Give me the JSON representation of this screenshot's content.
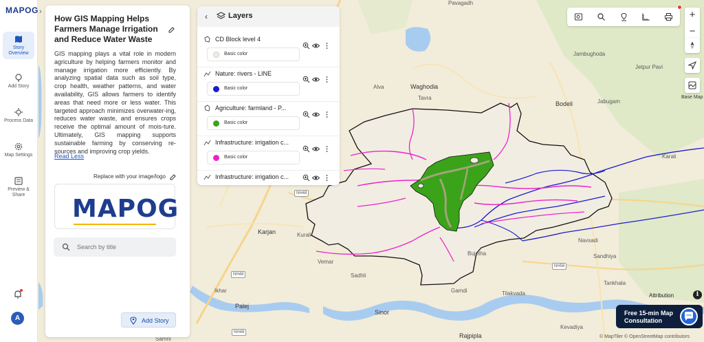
{
  "app": {
    "logo": "MAPOG"
  },
  "rail": {
    "items": [
      {
        "label": "Story Overview",
        "icon": "map-book-icon",
        "active": true
      },
      {
        "label": "Add Story",
        "icon": "pin-add-icon",
        "active": false
      },
      {
        "label": "Process Data",
        "icon": "process-icon",
        "active": false
      },
      {
        "label": "Map Settings",
        "icon": "gear-icon",
        "active": false
      },
      {
        "label": "Preview & Share",
        "icon": "preview-icon",
        "active": false
      }
    ],
    "avatar_initial": "A"
  },
  "story": {
    "title": "How GIS Mapping Helps Farmers Manage Irrigation and Reduce Water Waste",
    "body": "GIS mapping plays a vital role in modern agriculture by helping farmers monitor and manage irrigation more efficiently. By analyzing spatial data such as soil type, crop health, weather patterns, and water availability, GIS allows farmers to identify areas that need more or less water. This targeted approach minimizes overwater-ing, reduces water waste, and ensures crops receive the optimal amount of mois-ture. Ultimately, GIS mapping supports sustainable farming by conserving re-sources and improving crop yields.",
    "read_less": "Read Less",
    "replace_logo": "Replace with your image/logo",
    "logo_text": "MAPOG",
    "search_placeholder": "Search by title",
    "add_story": "Add Story"
  },
  "layers": {
    "title": "Layers",
    "items": [
      {
        "name": "CD Block level 4",
        "color_label": "Basic color",
        "color": "#f1ede2",
        "type": "polygon"
      },
      {
        "name": "Nature: rivers - LINE",
        "color_label": "Basic color",
        "color": "#1a1ad0",
        "type": "line"
      },
      {
        "name": "Agriculture: farmland - P...",
        "color_label": "Basic color",
        "color": "#3aa31a",
        "type": "polygon"
      },
      {
        "name": "Infrastructure: irrigation c...",
        "color_label": "Basic color",
        "color": "#ee22cc",
        "type": "line"
      },
      {
        "name": "Infrastructure: irrigation c...",
        "color_label": "",
        "color": "#ee22cc",
        "type": "line"
      }
    ]
  },
  "map": {
    "labels": [
      "Pavagadh",
      "Jambughoda",
      "Jetpur Pavi",
      "Alva",
      "Waghodia",
      "Tavra",
      "Bodeli",
      "Jabugam",
      "Karjan",
      "Kurali",
      "Vemar",
      "Sadhli",
      "Ikhar",
      "Palej",
      "Sinor",
      "Rajpipla",
      "Kevadiya",
      "Samni",
      "Gamdi",
      "Tilakvada",
      "Bujetha",
      "Navsadi",
      "Sandhiya",
      "Tankhala",
      "Karali"
    ],
    "shields": [
      "NH48",
      "NH48",
      "NH56",
      "NH48"
    ],
    "colors": {
      "boundary_fill": "#f1ede2",
      "river": "#1a1ad0",
      "farmland": "#3aa31a",
      "irrigation": "#ee22cc"
    }
  },
  "controls": {
    "zoom_in": "+",
    "zoom_out": "−",
    "base_map": "Base Map",
    "attribution": "Attribution",
    "info": "i",
    "consult_line1": "Free 15-min Map",
    "consult_line2": "Consultation",
    "footer": "© MapTiler © OpenStreetMap contributors"
  }
}
